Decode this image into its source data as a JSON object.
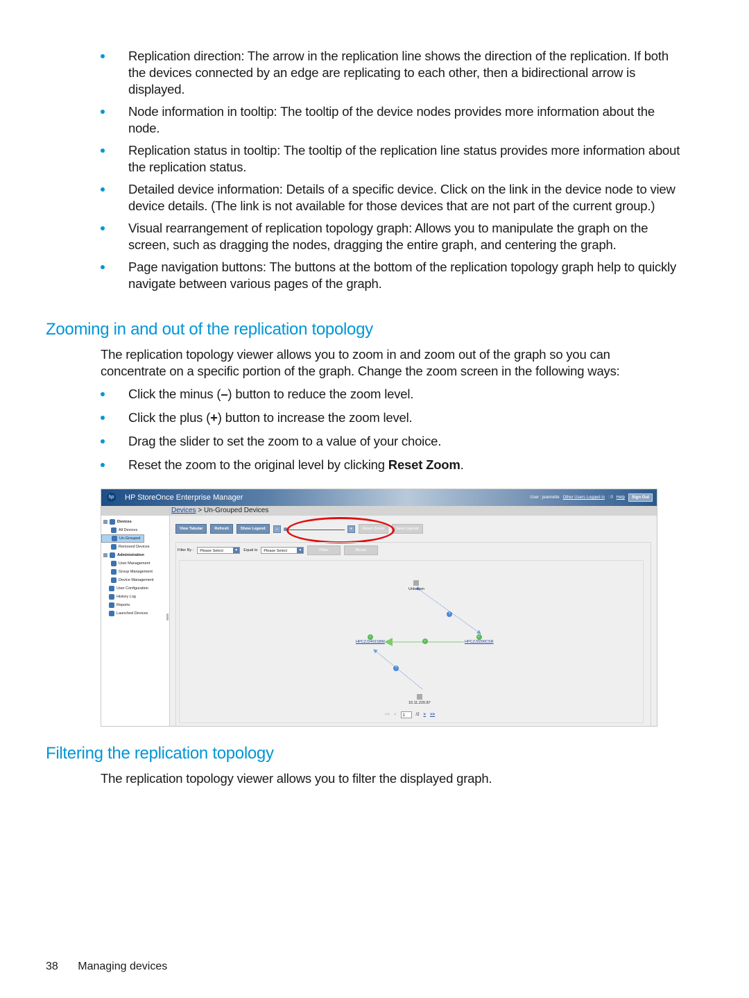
{
  "intro_bullets": [
    "Replication direction: The arrow in the replication line shows the direction of the replication. If both the devices connected by an edge are replicating to each other, then a bidirectional arrow is displayed.",
    "Node information in tooltip: The tooltip of the device nodes provides more information about the node.",
    "Replication status in tooltip: The tooltip of the replication line status provides more information about the replication status.",
    "Detailed device information: Details of a specific device. Click on the link in the device node to view device details. (The link is not available for those devices that are not part of the current group.)",
    "Visual rearrangement of replication topology graph: Allows you to manipulate the graph on the screen, such as dragging the nodes, dragging the entire graph, and centering the graph.",
    "Page navigation buttons: The buttons at the bottom of the replication topology graph help to quickly navigate between various pages of the graph."
  ],
  "zoom_section": {
    "heading": "Zooming in and out of the replication topology",
    "intro": "The replication topology viewer allows you to zoom in and zoom out of the graph so you can concentrate on a specific portion of the graph. Change the zoom screen in the following ways:",
    "bullets": [
      {
        "pre": "Click the minus (",
        "bold": "–",
        "post": ") button to reduce the zoom level."
      },
      {
        "pre": "Click the plus (",
        "bold": "+",
        "post": ") button to increase the zoom level."
      },
      {
        "pre": "Drag the slider to set the zoom to a value of your choice.",
        "bold": "",
        "post": ""
      },
      {
        "pre": "Reset the zoom to the original level by clicking ",
        "bold": "Reset Zoom",
        "post": "."
      }
    ]
  },
  "screenshot": {
    "app_title": "HP StoreOnce Enterprise Manager",
    "logo": "hp",
    "user_label": "User : jeannette",
    "other_users_link": "Other Users Logged in",
    "other_users_count": ": 0",
    "help_link": "Help",
    "sign_out": "Sign Out",
    "breadcrumb_root": "Devices",
    "breadcrumb_sep": ">",
    "breadcrumb_current": "Un-Grouped Devices",
    "sidebar": [
      {
        "label": "Devices",
        "icon": "devices-icon",
        "level": 0,
        "bold": true,
        "expander": true
      },
      {
        "label": "All Devices",
        "icon": "device-icon",
        "level": 1
      },
      {
        "label": "Un-Grouped",
        "icon": "device-icon",
        "level": 1,
        "selected": true
      },
      {
        "label": "Removed Devices",
        "icon": "device-icon",
        "level": 1
      },
      {
        "label": "Administration",
        "icon": "admin-icon",
        "level": 0,
        "bold": true,
        "expander": true
      },
      {
        "label": "User Management",
        "icon": "users-icon",
        "level": 1
      },
      {
        "label": "Group Management",
        "icon": "device-icon",
        "level": 1
      },
      {
        "label": "Device Management",
        "icon": "device-icon",
        "level": 1
      },
      {
        "label": "User Configuration",
        "icon": "user-icon",
        "level": 0
      },
      {
        "label": "History Log",
        "icon": "log-icon",
        "level": 0
      },
      {
        "label": "Reports",
        "icon": "report-icon",
        "level": 0
      },
      {
        "label": "Launched Devices",
        "icon": "device-icon",
        "level": 0
      }
    ],
    "toolbar": {
      "view_tabular": "View Tabular",
      "refresh": "Refresh",
      "show_legend": "Show Legend",
      "zoom_minus": "–",
      "zoom_plus": "+",
      "zoom_level_fraction": 0.0,
      "reset_zoom": "Reset Zoom",
      "save_layout": "Save Layout"
    },
    "filter": {
      "filter_by_label": "Filter By :",
      "filter_by_value": "Please Select",
      "equal_to_label": "Equal to",
      "equal_to_value": "Please Select",
      "filter_button": "Filter",
      "reset_button": "Reset"
    },
    "graph": {
      "nodes": [
        {
          "id": "unknown",
          "label": "Unknown",
          "link": false,
          "status": "unknown"
        },
        {
          "id": "left",
          "label": "HPCZJ2491S8W",
          "link": true,
          "status": "ok"
        },
        {
          "id": "right",
          "label": "HPCZJ0290CSR",
          "link": true,
          "status": "ok"
        },
        {
          "id": "ip",
          "label": "10.11.220.87",
          "link": false,
          "status": "unknown"
        }
      ],
      "edges": [
        {
          "from": "unknown",
          "to": "right",
          "status": "?",
          "bidirectional": true
        },
        {
          "from": "right",
          "to": "left",
          "status": "ok",
          "bidirectional": false
        },
        {
          "from": "ip",
          "to": "left",
          "status": "?",
          "bidirectional": false
        }
      ]
    },
    "pager": {
      "first": "<<",
      "prev": "<",
      "current_page": "1",
      "total": "/2",
      "next": ">",
      "last": ">>"
    }
  },
  "filter_section": {
    "heading": "Filtering the replication topology",
    "intro": "The replication topology viewer allows you to filter the displayed graph."
  },
  "footer": {
    "page_number": "38",
    "section": "Managing devices"
  },
  "colors": {
    "heading": "#0096d6",
    "bullet": "#0096d6",
    "highlight_ring": "#e01010"
  }
}
